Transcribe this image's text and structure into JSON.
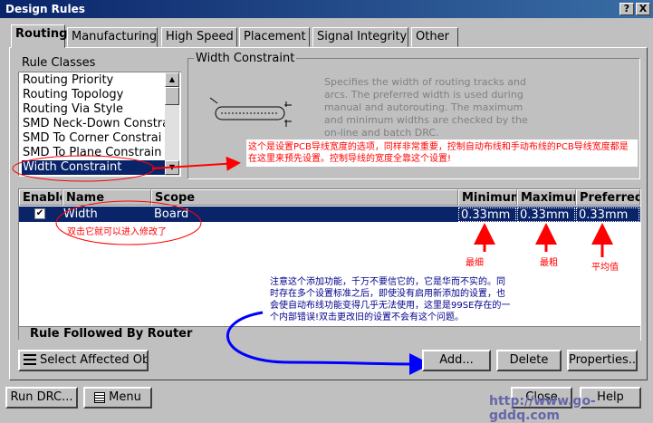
{
  "window": {
    "title": "Design Rules",
    "help_btn": "?",
    "close_btn": "X"
  },
  "tabs": [
    {
      "label": "Routing"
    },
    {
      "label": "Manufacturing"
    },
    {
      "label": "High Speed"
    },
    {
      "label": "Placement"
    },
    {
      "label": "Signal Integrity"
    },
    {
      "label": "Other"
    }
  ],
  "rule_classes": {
    "header": "Rule Classes",
    "items": [
      "Routing Priority",
      "Routing Topology",
      "Routing Via Style",
      "SMD Neck-Down Constra",
      "SMD To Corner Constrai",
      "SMD To Plane Constrain",
      "Width Constraint"
    ],
    "selected_index": 6
  },
  "width_constraint": {
    "title": "Width Constraint",
    "description": "Specifies the width of routing tracks and arcs. The preferred width is used during manual and autorouting. The maximum and minimum widths are checked by the on-line and batch DRC."
  },
  "grid": {
    "headers": {
      "enable": "Enable",
      "name": "Name",
      "scope": "Scope",
      "minimum": "Minimum",
      "maximum": "Maximum",
      "preferred": "Preferred"
    },
    "rows": [
      {
        "name": "Width",
        "scope": "Board",
        "minimum": "0.33mm",
        "maximum": "0.33mm",
        "preferred": "0.33mm"
      }
    ],
    "footer": "Rule Followed By Router"
  },
  "buttons": {
    "select_affected": "Select Affected Obj",
    "add": "Add...",
    "delete": "Delete",
    "properties": "Properties..",
    "run_drc": "Run DRC...",
    "menu": "Menu",
    "close": "Close",
    "help": "Help"
  },
  "annotations": {
    "top_note": "这个是设置PCB导线宽度的选项，同样非常重要，控制自动布线和手动布线的PCB导线宽度都是在这里来预先设置。控制导线的宽度全靠这个设置!",
    "row_note": "双击它就可以进入修改了",
    "min_note": "最细",
    "max_note": "最粗",
    "pref_note": "平均值",
    "add_note": "注意这个添加功能，千万不要信它的，它是华而不实的。同时存在多个设置标准之后，即使没有启用新添加的设置，也会使自动布线功能变得几乎无法使用，这里是99SE存在的一个内部错误!双击更改旧的设置不会有这个问题。"
  },
  "watermark": "http://www.go-gddq.com",
  "colors": {
    "selection": "#0a246a",
    "annotation": "#ff0000",
    "note_text": "#00008b",
    "arrow_blue": "#0000ff"
  }
}
